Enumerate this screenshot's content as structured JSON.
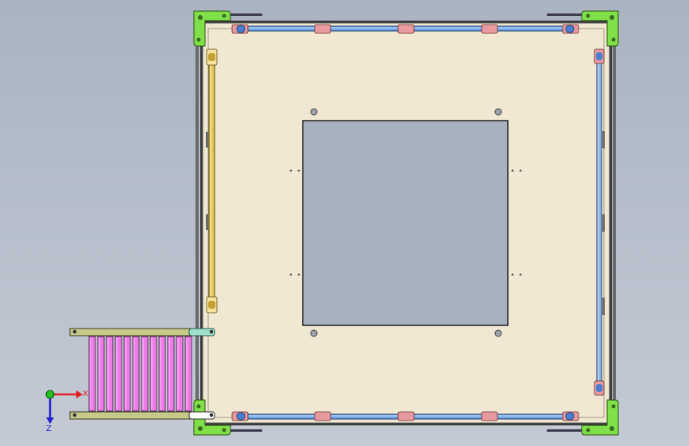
{
  "viewport": {
    "background_color": "#b2bcc8"
  },
  "model": {
    "plate_color": "#f0e8d2",
    "opening_color": "#a8b2bf",
    "corner_bracket_color": "#7fe04a",
    "top_bottom_rail_color": "#6fa6e6",
    "left_rail_color": "#e6c75a",
    "right_rail_color": "#8fb7e6",
    "clip_color": "#e79aa0",
    "roller_color": "#ee7be8",
    "conveyor_side_color": "#c7c98a",
    "conveyor_end_color": "#9fe0cc"
  },
  "axis_triad": {
    "x_label": "X",
    "z_label": "Z",
    "x_color": "#e02020",
    "y_color": "#22c022",
    "z_color": "#2020d0"
  }
}
